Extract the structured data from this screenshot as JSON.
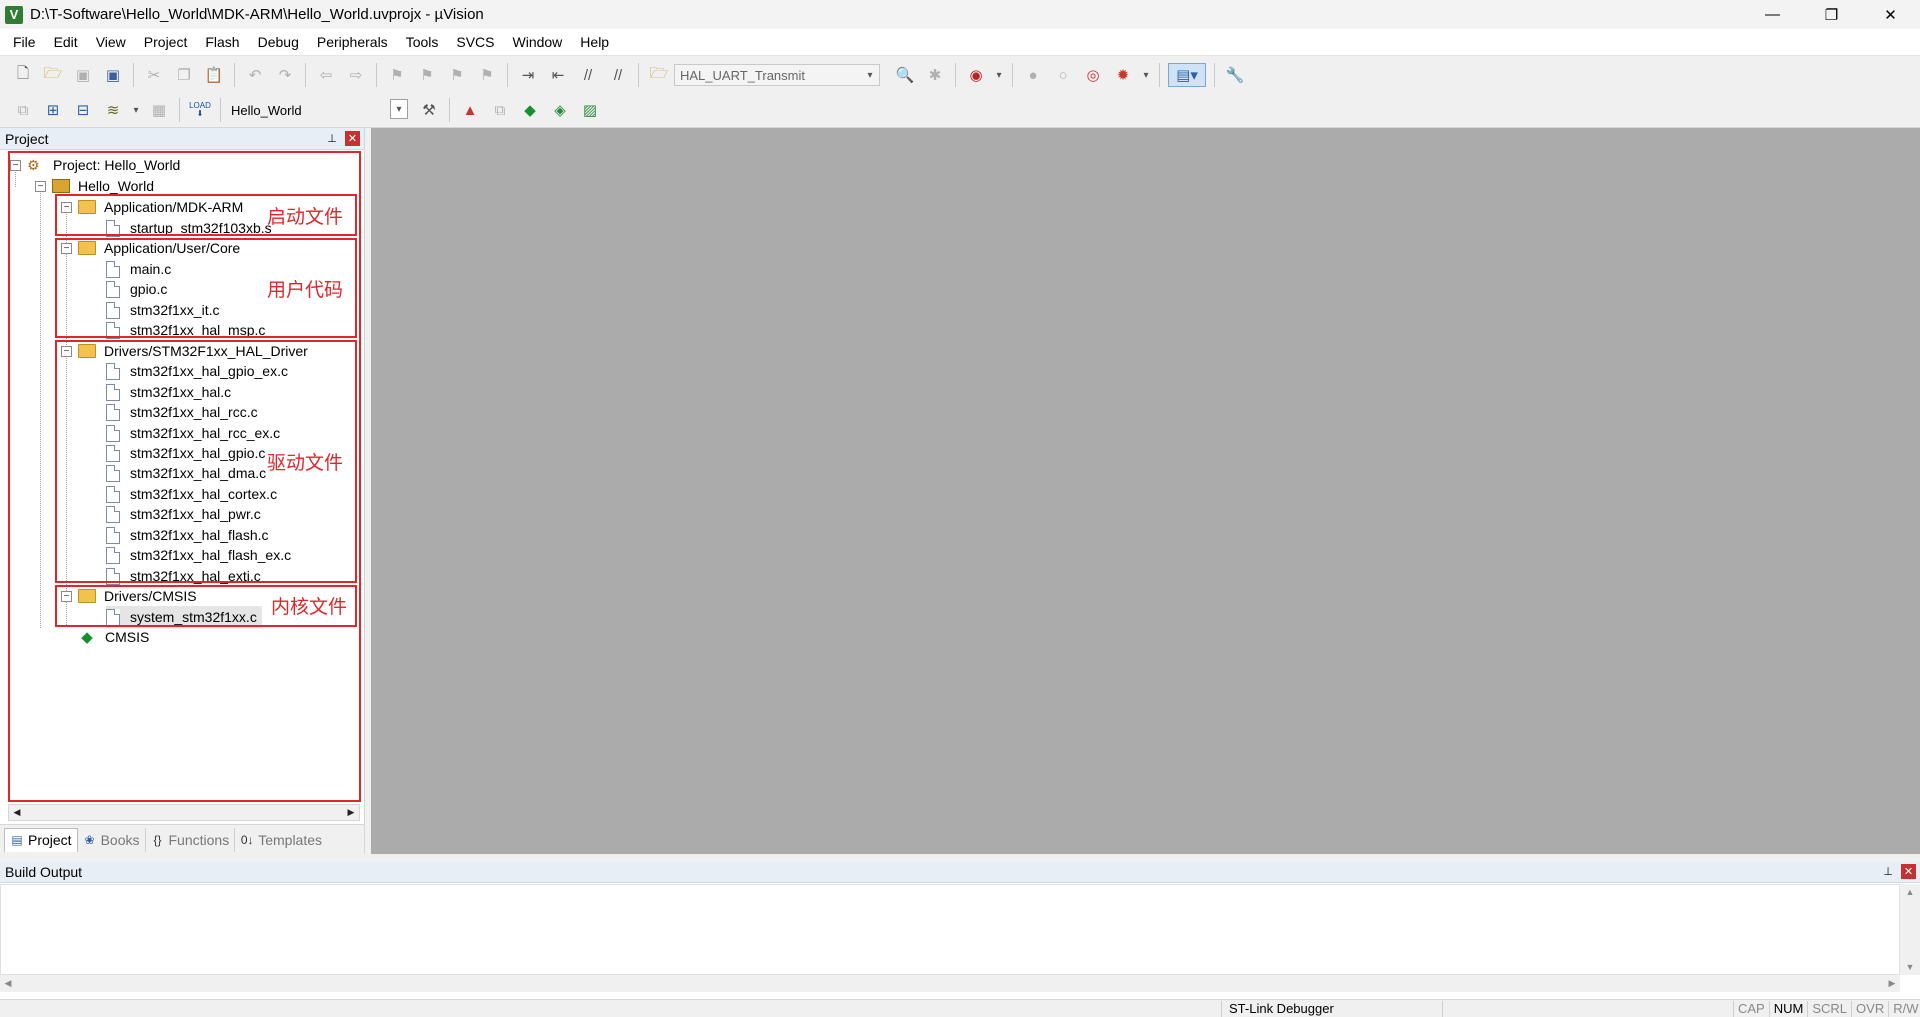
{
  "window": {
    "title": "D:\\T-Software\\Hello_World\\MDK-ARM\\Hello_World.uvprojx - µVision",
    "app_icon": "V",
    "minimize": "—",
    "restore": "❐",
    "close": "✕"
  },
  "menu": [
    "File",
    "Edit",
    "View",
    "Project",
    "Flash",
    "Debug",
    "Peripherals",
    "Tools",
    "SVCS",
    "Window",
    "Help"
  ],
  "toolbar": {
    "function_combo": "HAL_UART_Transmit",
    "target_combo": "Hello_World",
    "load_label": "LOAD"
  },
  "project_panel": {
    "title": "Project",
    "pin": "⊥",
    "close": "✕",
    "tree": {
      "project": "Project: Hello_World",
      "target": "Hello_World",
      "groups": [
        {
          "name": "Application/MDK-ARM",
          "files": [
            "startup_stm32f103xb.s"
          ]
        },
        {
          "name": "Application/User/Core",
          "files": [
            "main.c",
            "gpio.c",
            "stm32f1xx_it.c",
            "stm32f1xx_hal_msp.c"
          ]
        },
        {
          "name": "Drivers/STM32F1xx_HAL_Driver",
          "files": [
            "stm32f1xx_hal_gpio_ex.c",
            "stm32f1xx_hal.c",
            "stm32f1xx_hal_rcc.c",
            "stm32f1xx_hal_rcc_ex.c",
            "stm32f1xx_hal_gpio.c",
            "stm32f1xx_hal_dma.c",
            "stm32f1xx_hal_cortex.c",
            "stm32f1xx_hal_pwr.c",
            "stm32f1xx_hal_flash.c",
            "stm32f1xx_hal_flash_ex.c",
            "stm32f1xx_hal_exti.c"
          ]
        },
        {
          "name": "Drivers/CMSIS",
          "files": [
            "system_stm32f1xx.c"
          ]
        }
      ],
      "cmsis": "CMSIS"
    },
    "annotations": {
      "startup": "启动文件",
      "user_code": "用户代码",
      "driver": "驱动文件",
      "core": "内核文件"
    },
    "tabs": {
      "project": "Project",
      "books": "Books",
      "functions": "Functions",
      "templates": "Templates"
    }
  },
  "build_output": {
    "title": "Build Output"
  },
  "status": {
    "debugger": "ST-Link Debugger",
    "cap": "CAP",
    "num": "NUM",
    "scrl": "SCRL",
    "ovr": "OVR",
    "rw": "R/W"
  },
  "colors": {
    "annotation_red": "#e0262b",
    "editor_bg": "#ababab",
    "panel_header": "#e8eef6"
  }
}
